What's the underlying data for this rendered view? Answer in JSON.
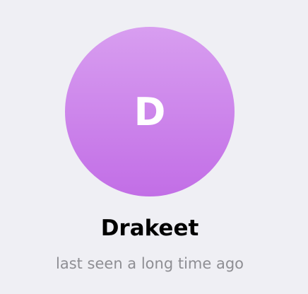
{
  "profile": {
    "avatar_initial": "D",
    "name": "Drakeet",
    "status": "last seen a long time ago",
    "avatar_gradient_top": "#d89ef0",
    "avatar_gradient_bottom": "#c26ee6"
  },
  "colors": {
    "background": "#efeff4",
    "name_text": "#000000",
    "status_text": "#8e8e93"
  }
}
